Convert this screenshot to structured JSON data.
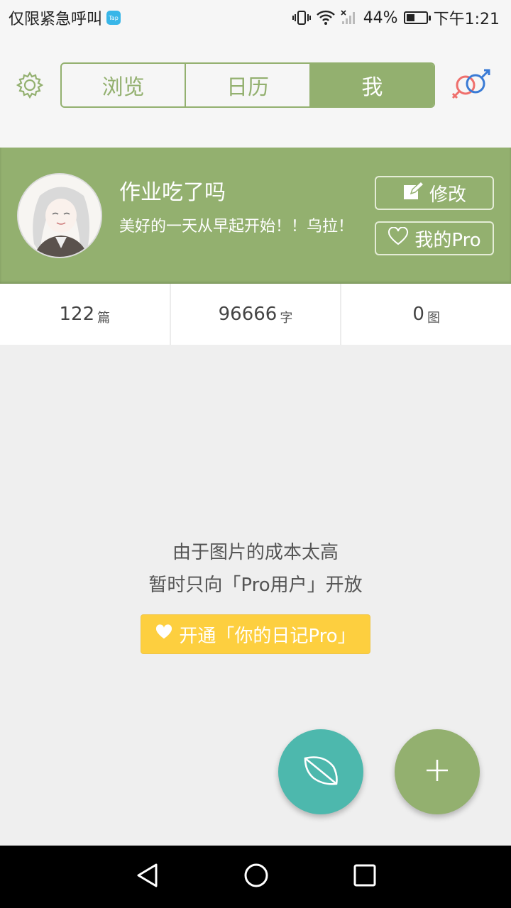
{
  "status_bar": {
    "carrier": "仅限紧急呼叫",
    "app_badge": "Tap",
    "battery": "44%",
    "time": "下午1:21",
    "battery_level": 0.44
  },
  "tabs": [
    {
      "label": "浏览",
      "active": false
    },
    {
      "label": "日历",
      "active": false
    },
    {
      "label": "我",
      "active": true
    }
  ],
  "profile": {
    "username": "作业吃了吗",
    "bio": "美好的一天从早起开始！！乌拉！",
    "edit_label": "修改",
    "pro_label": "我的Pro"
  },
  "stats": [
    {
      "value": "122",
      "unit": "篇"
    },
    {
      "value": "96666",
      "unit": "字"
    },
    {
      "value": "0",
      "unit": "图"
    }
  ],
  "notice": {
    "line1": "由于图片的成本太高",
    "line2": "暂时只向「Pro用户」开放",
    "button": "开通「你的日记Pro」"
  },
  "colors": {
    "accent": "#93b06f",
    "teal": "#4db8ad",
    "yellow": "#fdcf3f"
  },
  "icons": [
    "gear-icon",
    "gender-icon",
    "edit-icon",
    "heart-icon",
    "leaf-icon",
    "plus-icon",
    "back-icon",
    "home-icon",
    "recents-icon"
  ]
}
